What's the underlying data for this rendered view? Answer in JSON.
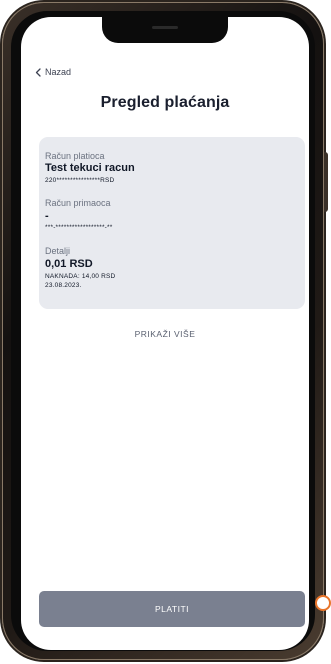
{
  "header": {
    "back_label": "Nazad",
    "title": "Pregled plaćanja"
  },
  "details": {
    "payer": {
      "label": "Račun platioca",
      "name": "Test tekuci racun",
      "account": "220****************RSD"
    },
    "recipient": {
      "label": "Račun primaoca",
      "name": "-",
      "account": "***-******************-**"
    },
    "info": {
      "label": "Detalji",
      "amount": "0,01 RSD",
      "fee": "NAKNADA: 14,00 RSD",
      "date": "23.08.2023."
    }
  },
  "show_more_label": "PRIKAŽI VIŠE",
  "pay_button_label": "PLATITI",
  "colors": {
    "card_background": "#e8eaef",
    "pay_button": "#7a8090",
    "title": "#1a1f2e",
    "accent_ring": "#e8742a"
  },
  "icons": {
    "back": "chevron-left-icon"
  }
}
